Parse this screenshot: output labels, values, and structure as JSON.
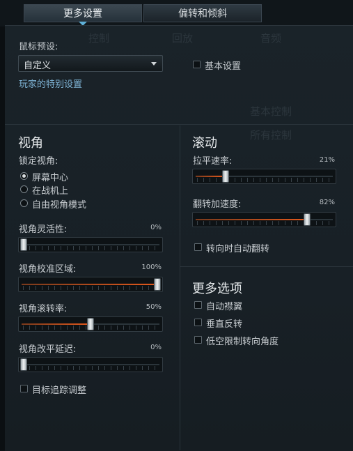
{
  "tabs": [
    {
      "label": "更多设置",
      "active": true
    },
    {
      "label": "偏转和倾斜",
      "active": false
    }
  ],
  "background_ghost": [
    "控制",
    "回放",
    "音频",
    "基本控制",
    "所有控制"
  ],
  "preset": {
    "label": "鼠标预设:",
    "selected": "自定义",
    "special_link": "玩家的特别设置",
    "basic_settings_label": "基本设置",
    "basic_settings_checked": false
  },
  "view": {
    "heading": "视角",
    "lock_label": "锁定视角:",
    "lock_options": [
      {
        "label": "屏幕中心",
        "selected": true
      },
      {
        "label": "在战机上",
        "selected": false
      },
      {
        "label": "自由视角模式",
        "selected": false
      }
    ],
    "sliders": [
      {
        "label": "视角灵活性:",
        "value_text": "0%",
        "value": 0
      },
      {
        "label": "视角校准区域:",
        "value_text": "100%",
        "value": 100
      },
      {
        "label": "视角滚转率:",
        "value_text": "50%",
        "value": 50
      },
      {
        "label": "视角改平延迟:",
        "value_text": "0%",
        "value": 0
      }
    ],
    "target_tracking_label": "目标追踪调整",
    "target_tracking_checked": false
  },
  "roll": {
    "heading": "滚动",
    "sliders": [
      {
        "label": "拉平速率:",
        "value_text": "21%",
        "value": 21
      },
      {
        "label": "翻转加速度:",
        "value_text": "82%",
        "value": 82
      }
    ],
    "auto_flip_label": "转向时自动翻转",
    "auto_flip_checked": false
  },
  "more": {
    "heading": "更多选项",
    "options": [
      {
        "label": "自动襟翼",
        "checked": false
      },
      {
        "label": "垂直反转",
        "checked": false
      },
      {
        "label": "低空限制转向角度",
        "checked": false
      }
    ]
  },
  "colors": {
    "accent": "#5fb0d8",
    "fill": "#e0581c",
    "link": "#7fb4d6"
  }
}
